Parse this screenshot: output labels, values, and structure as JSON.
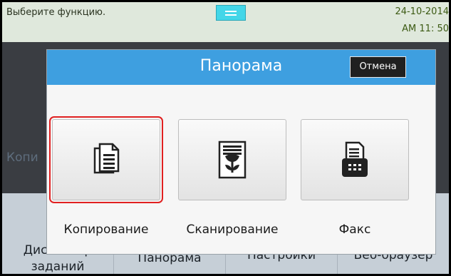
{
  "status_bar": {
    "message": "Выберите функцию.",
    "date": "24-10-2014",
    "time": "AM 11: 50"
  },
  "home": {
    "copy_tile_label": "Копи",
    "tabs": [
      {
        "lines": [
          "Диспетчер",
          "заданий"
        ]
      },
      {
        "lines": [
          "Панорама"
        ]
      },
      {
        "lines": [
          "Настройки"
        ]
      },
      {
        "lines": [
          "Веб-браузер"
        ]
      }
    ]
  },
  "dialog": {
    "title": "Панорама",
    "cancel_label": "Отмена",
    "functions": [
      {
        "label": "Копирование",
        "icon": "copy-icon",
        "selected": true
      },
      {
        "label": "Сканирование",
        "icon": "scan-icon",
        "selected": false
      },
      {
        "label": "Факс",
        "icon": "fax-icon",
        "selected": false
      }
    ]
  },
  "colors": {
    "header": "#3e9fe0",
    "selection": "#e02020",
    "handle": "#43d6e8"
  }
}
